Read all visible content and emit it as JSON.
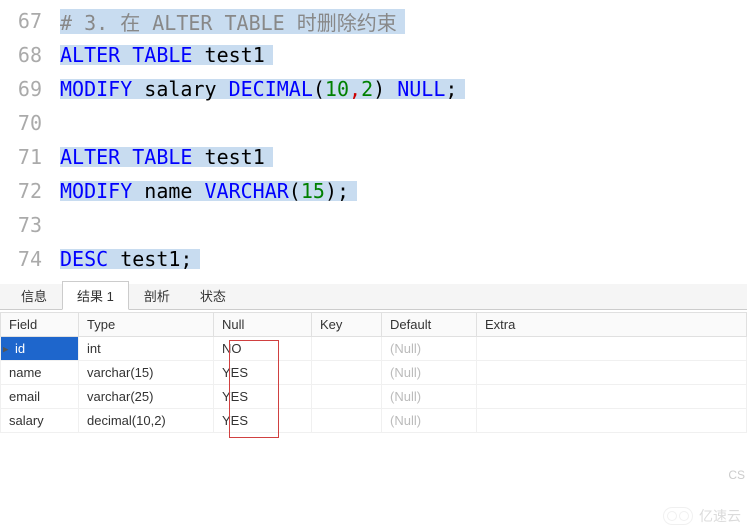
{
  "code": {
    "lines": [
      {
        "n": "67",
        "tokens": [
          {
            "t": "# 3. 在 ALTER TABLE 时删除约束",
            "c": "comment"
          }
        ],
        "sel": true
      },
      {
        "n": "68",
        "tokens": [
          {
            "t": "ALTER",
            "c": "kw"
          },
          {
            "t": " ",
            "c": ""
          },
          {
            "t": "TABLE",
            "c": "kw"
          },
          {
            "t": " test1",
            "c": "ident"
          }
        ],
        "sel": true
      },
      {
        "n": "69",
        "tokens": [
          {
            "t": "MODIFY",
            "c": "kw"
          },
          {
            "t": " salary ",
            "c": "ident"
          },
          {
            "t": "DECIMAL",
            "c": "func"
          },
          {
            "t": "(",
            "c": "punct"
          },
          {
            "t": "10",
            "c": "num"
          },
          {
            "t": ",",
            "c": "comma-red"
          },
          {
            "t": "2",
            "c": "num"
          },
          {
            "t": ") ",
            "c": "punct"
          },
          {
            "t": "NULL",
            "c": "kw"
          },
          {
            "t": ";",
            "c": "punct"
          }
        ],
        "sel": true
      },
      {
        "n": "70",
        "tokens": [],
        "sel": true
      },
      {
        "n": "71",
        "tokens": [
          {
            "t": "ALTER",
            "c": "kw"
          },
          {
            "t": " ",
            "c": ""
          },
          {
            "t": "TABLE",
            "c": "kw"
          },
          {
            "t": " test1",
            "c": "ident"
          }
        ],
        "sel": true
      },
      {
        "n": "72",
        "tokens": [
          {
            "t": "MODIFY",
            "c": "kw"
          },
          {
            "t": " name ",
            "c": "ident"
          },
          {
            "t": "VARCHAR",
            "c": "func"
          },
          {
            "t": "(",
            "c": "punct"
          },
          {
            "t": "15",
            "c": "num"
          },
          {
            "t": ");",
            "c": "punct"
          }
        ],
        "sel": true
      },
      {
        "n": "73",
        "tokens": [],
        "sel": true
      },
      {
        "n": "74",
        "tokens": [
          {
            "t": "DESC",
            "c": "kw"
          },
          {
            "t": " test1;",
            "c": "ident"
          }
        ],
        "sel": true
      }
    ]
  },
  "tabs": [
    {
      "label": "信息",
      "active": false
    },
    {
      "label": "结果 1",
      "active": true
    },
    {
      "label": "剖析",
      "active": false
    },
    {
      "label": "状态",
      "active": false
    }
  ],
  "table": {
    "headers": [
      "Field",
      "Type",
      "Null",
      "Key",
      "Default",
      "Extra"
    ],
    "rows": [
      {
        "field": "id",
        "type": "int",
        "null": "NO",
        "key": "",
        "default": "(Null)",
        "extra": "",
        "current": true,
        "selected": true
      },
      {
        "field": "name",
        "type": "varchar(15)",
        "null": "YES",
        "key": "",
        "default": "(Null)",
        "extra": ""
      },
      {
        "field": "email",
        "type": "varchar(25)",
        "null": "YES",
        "key": "",
        "default": "(Null)",
        "extra": ""
      },
      {
        "field": "salary",
        "type": "decimal(10,2)",
        "null": "YES",
        "key": "",
        "default": "(Null)",
        "extra": ""
      }
    ]
  },
  "watermark": "亿速云",
  "cs": "CS"
}
